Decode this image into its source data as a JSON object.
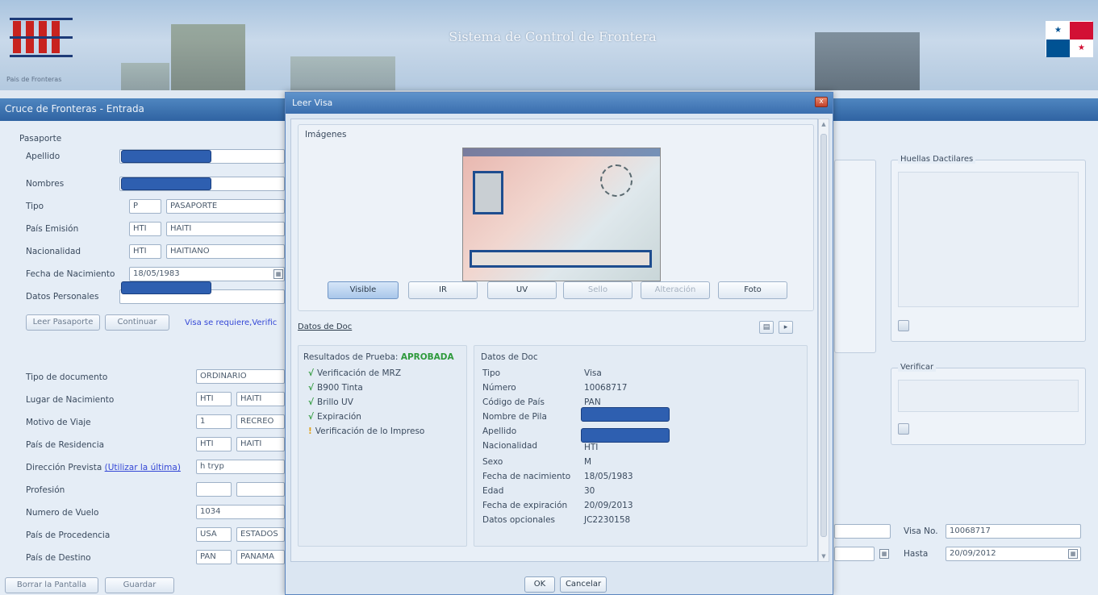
{
  "banner": {
    "title": "Sistema de Control de Frontera",
    "subtitle": "Pais de Fronteras"
  },
  "window": {
    "title": "Cruce de Fronteras - Entrada"
  },
  "passport": {
    "section_label": "Pasaporte",
    "apellido_label": "Apellido",
    "nombres_label": "Nombres",
    "tipo_label": "Tipo",
    "tipo_code": "P",
    "tipo_value": "PASAPORTE",
    "pais_emision_label": "País Emisión",
    "pais_emision_code": "HTI",
    "pais_emision_value": "HAITI",
    "nacionalidad_label": "Nacionalidad",
    "nacionalidad_code": "HTI",
    "nacionalidad_value": "HAITIANO",
    "fecha_nac_label": "Fecha de Nacimiento",
    "fecha_nac_value": "18/05/1983",
    "datos_personales_label": "Datos Personales",
    "leer_pasaporte_btn": "Leer Pasaporte",
    "continuar_btn": "Continuar",
    "visa_notice": "Visa se requiere,Verific"
  },
  "travel": {
    "tipo_doc_label": "Tipo de documento",
    "tipo_doc_value": "ORDINARIO",
    "lugar_nac_label": "Lugar de Nacimiento",
    "lugar_nac_code": "HTI",
    "lugar_nac_value": "HAITI",
    "motivo_label": "Motivo de Viaje",
    "motivo_code": "1",
    "motivo_value": "RECREO",
    "residencia_label": "País de Residencia",
    "residencia_code": "HTI",
    "residencia_value": "HAITI",
    "direccion_label": "Dirección Prevista",
    "direccion_link": "(Utilizar la última)",
    "direccion_value": "h tryp",
    "profesion_label": "Profesión",
    "vuelo_label": "Numero de Vuelo",
    "vuelo_value": "1034",
    "procedencia_label": "País de  Procedencia",
    "procedencia_code": "USA",
    "procedencia_value": "ESTADOS",
    "destino_label": "País de  Destino",
    "destino_code": "PAN",
    "destino_value": "PANAMA",
    "borrar_btn": "Borrar la Pantalla",
    "guardar_btn": "Guardar"
  },
  "right_panel": {
    "huellas_label": "Huellas Dactilares",
    "verificar_label": "Verificar",
    "visa_no_label": "Visa No.",
    "visa_no_value": "10068717",
    "hasta_label": "Hasta",
    "hasta_value": "20/09/2012"
  },
  "dialog": {
    "title": "Leer Visa",
    "close_label": "x",
    "imagenes_label": "Imágenes",
    "tabs": [
      {
        "label": "Visible"
      },
      {
        "label": "IR"
      },
      {
        "label": "UV"
      },
      {
        "label": "Sello"
      },
      {
        "label": "Alteración"
      },
      {
        "label": "Foto"
      }
    ],
    "datos_doc_link": "Datos de Doc",
    "results_title": "Resultados de Prueba:",
    "results_status": "APROBADA",
    "checks": [
      {
        "label": "Verificación de MRZ",
        "status": "ok"
      },
      {
        "label": "B900 Tinta",
        "status": "ok"
      },
      {
        "label": "Brillo UV",
        "status": "ok"
      },
      {
        "label": "Expiración",
        "status": "ok"
      },
      {
        "label": "Verificación  de lo Impreso",
        "status": "warn"
      }
    ],
    "doc_title": "Datos de Doc",
    "doc_fields": [
      {
        "label": "Tipo",
        "value": "Visa"
      },
      {
        "label": "Número",
        "value": "10068717"
      },
      {
        "label": "Código de País",
        "value": "PAN"
      },
      {
        "label": "Nombre de Pila",
        "value": ""
      },
      {
        "label": "Apellido",
        "value": ""
      },
      {
        "label": "Nacionalidad",
        "value": "HTI"
      },
      {
        "label": "Sexo",
        "value": "M"
      },
      {
        "label": "Fecha de nacimiento",
        "value": "18/05/1983"
      },
      {
        "label": "Edad",
        "value": "30"
      },
      {
        "label": "Fecha de expiración",
        "value": "20/09/2013"
      },
      {
        "label": "Datos opcionales",
        "value": "JC2230158"
      }
    ],
    "ok_btn": "OK",
    "cancel_btn": "Cancelar"
  },
  "colors": {
    "title_bar": "#3a6eae",
    "approved": "#2e9a3c",
    "warning": "#e0a21c",
    "redaction": "#2e5fb0"
  }
}
